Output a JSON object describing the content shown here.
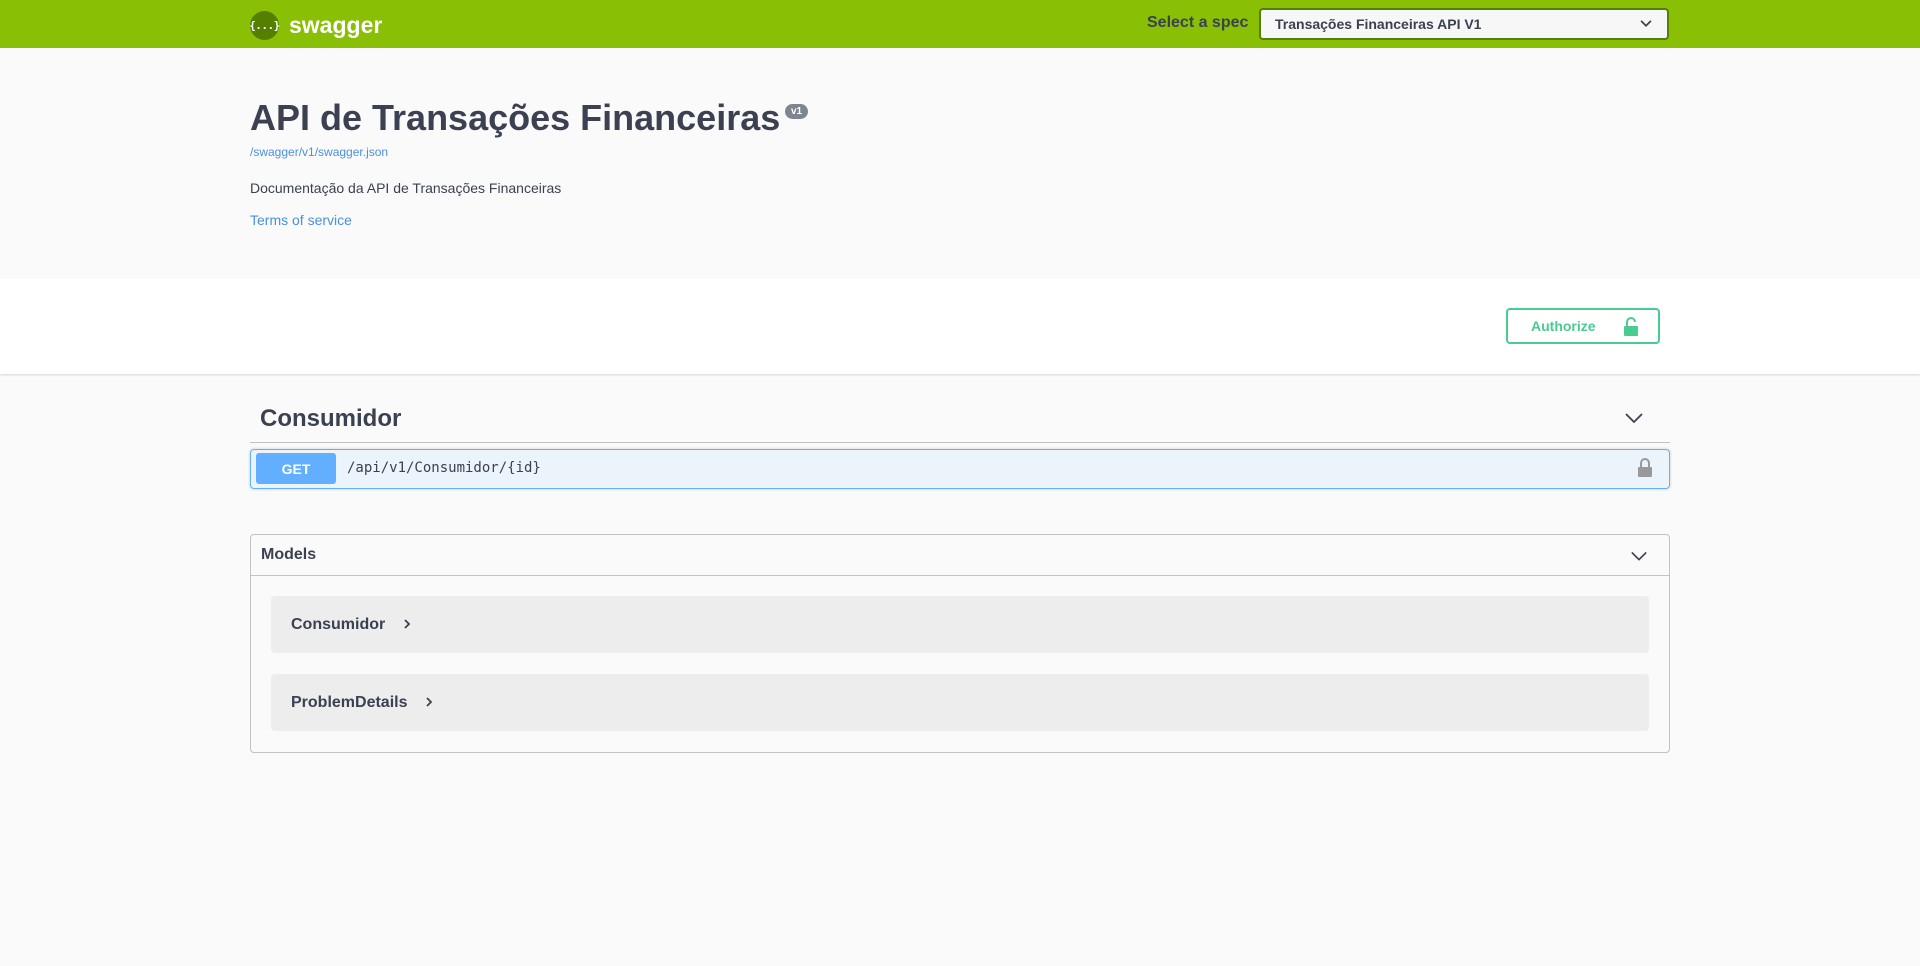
{
  "topbar": {
    "logo_glyph": "{...}",
    "logo_text": "swagger",
    "spec_label": "Select a spec",
    "spec_selected": "Transações Financeiras API V1",
    "color": "#89bf04"
  },
  "info": {
    "title": "API de Transações Financeiras",
    "version": "v1",
    "spec_url": "/swagger/v1/swagger.json",
    "description": "Documentação da API de Transações Financeiras",
    "terms_label": "Terms of service"
  },
  "auth": {
    "authorize_label": "Authorize",
    "color": "#49cc90"
  },
  "tags": [
    {
      "name": "Consumidor",
      "operations": [
        {
          "method": "GET",
          "path": "/api/v1/Consumidor/{id}",
          "color": "#61affe"
        }
      ]
    }
  ],
  "models": {
    "title": "Models",
    "items": [
      "Consumidor",
      "ProblemDetails"
    ]
  },
  "icons": [
    "logo-icon",
    "chevron-down-icon",
    "lock-icon",
    "chevron-right-icon"
  ]
}
